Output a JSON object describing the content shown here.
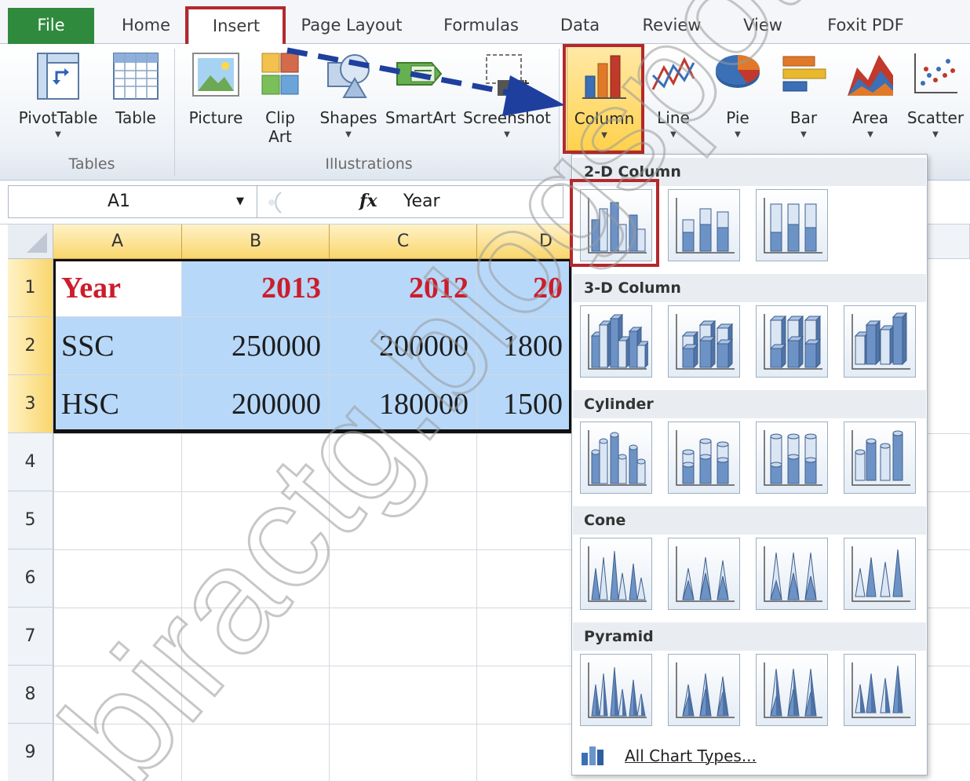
{
  "tabs": [
    "File",
    "Home",
    "Insert",
    "Page Layout",
    "Formulas",
    "Data",
    "Review",
    "View",
    "Foxit PDF"
  ],
  "ribbon": {
    "groups": {
      "tables": "Tables",
      "illustrations": "Illustrations"
    },
    "buttons": {
      "pivottable": "PivotTable",
      "table": "Table",
      "picture": "Picture",
      "clipart_line1": "Clip",
      "clipart_line2": "Art",
      "shapes": "Shapes",
      "smartart": "SmartArt",
      "screenshot": "Screenshot",
      "column": "Column",
      "line": "Line",
      "pie": "Pie",
      "bar": "Bar",
      "area": "Area",
      "scatter": "Scatter"
    }
  },
  "formula_bar": {
    "name_box": "A1",
    "fx": "fx",
    "value": "Year"
  },
  "grid": {
    "columns": [
      "A",
      "B",
      "C",
      "D"
    ],
    "rows": [
      "1",
      "2",
      "3",
      "4",
      "5",
      "6",
      "7",
      "8",
      "9"
    ],
    "cells": [
      [
        "Year",
        "2013",
        "2012",
        "20"
      ],
      [
        "SSC",
        "250000",
        "200000",
        "1800"
      ],
      [
        "HSC",
        "200000",
        "180000",
        "1500"
      ]
    ]
  },
  "gallery": {
    "sections": [
      "2-D Column",
      "3-D Column",
      "Cylinder",
      "Cone",
      "Pyramid"
    ],
    "all_chart_types": "All Chart Types..."
  },
  "watermark": "biractg.blogspot.com",
  "colors": {
    "file_tab": "#2f8a3d",
    "highlight_border": "#b3282d",
    "selection_fill": "#b7d8f9",
    "header_red": "#cc1d2c",
    "arrow": "#1e3f9e"
  }
}
